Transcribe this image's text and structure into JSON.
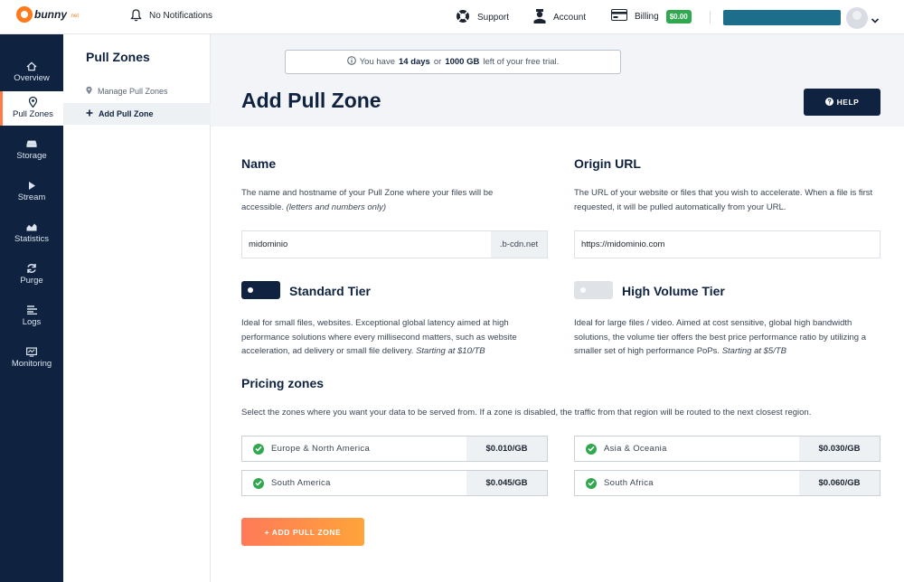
{
  "brand": {
    "name": "bunny",
    "tld": ".net"
  },
  "topbar": {
    "notifications": "No Notifications",
    "support": "Support",
    "account": "Account",
    "billing": "Billing",
    "balance": "$0.00"
  },
  "rail": {
    "items": [
      {
        "label": "Overview",
        "icon": "home-icon"
      },
      {
        "label": "Pull Zones",
        "icon": "location-pin-icon"
      },
      {
        "label": "Storage",
        "icon": "storage-icon"
      },
      {
        "label": "Stream",
        "icon": "play-icon"
      },
      {
        "label": "Statistics",
        "icon": "area-chart-icon"
      },
      {
        "label": "Purge",
        "icon": "refresh-icon"
      },
      {
        "label": "Logs",
        "icon": "list-icon"
      },
      {
        "label": "Monitoring",
        "icon": "monitor-icon"
      }
    ]
  },
  "subnav": {
    "title": "Pull Zones",
    "items": [
      {
        "label": "Manage Pull Zones"
      },
      {
        "label": "Add Pull Zone"
      }
    ]
  },
  "trial": {
    "prefix": "You have",
    "days": "14 days",
    "middle": "or",
    "gb": "1000 GB",
    "suffix": "left of your free trial."
  },
  "page": {
    "title": "Add Pull Zone",
    "help": "HELP"
  },
  "name_section": {
    "heading": "Name",
    "desc": "The name and hostname of your Pull Zone where your files will be accessible.",
    "desc_note": "(letters and numbers only)",
    "value": "midominio",
    "suffix": ".b-cdn.net"
  },
  "origin_section": {
    "heading": "Origin URL",
    "desc": "The URL of your website or files that you wish to accelerate. When a file is first requested, it will be pulled automatically from your URL.",
    "value": "https://midominio.com"
  },
  "tiers": {
    "standard": {
      "title": "Standard Tier",
      "selected": true,
      "desc": "Ideal for small files, websites. Exceptional global latency aimed at high performance solutions where every millisecond matters, such as website acceleration, ad delivery or small file delivery.",
      "price_note": "Starting at $10/TB"
    },
    "volume": {
      "title": "High Volume Tier",
      "selected": false,
      "desc": "Ideal for large files / video. Aimed at cost sensitive, global high bandwidth solutions, the volume tier offers the best price performance ratio by utilizing a smaller set of high performance PoPs.",
      "price_note": "Starting at $5/TB"
    }
  },
  "pricing": {
    "heading": "Pricing zones",
    "desc": "Select the zones where you want your data to be served from. If a zone is disabled, the traffic from that region will be routed to the next closest region.",
    "zones": [
      {
        "name": "Europe & North America",
        "price": "$0.010/GB",
        "enabled": true
      },
      {
        "name": "Asia & Oceania",
        "price": "$0.030/GB",
        "enabled": true
      },
      {
        "name": "South America",
        "price": "$0.045/GB",
        "enabled": true
      },
      {
        "name": "South Africa",
        "price": "$0.060/GB",
        "enabled": true
      }
    ]
  },
  "submit": {
    "label": "+ ADD PULL ZONE"
  },
  "colors": {
    "navy": "#0f2340",
    "accent": "#ff7a45",
    "success": "#2fa84f"
  }
}
